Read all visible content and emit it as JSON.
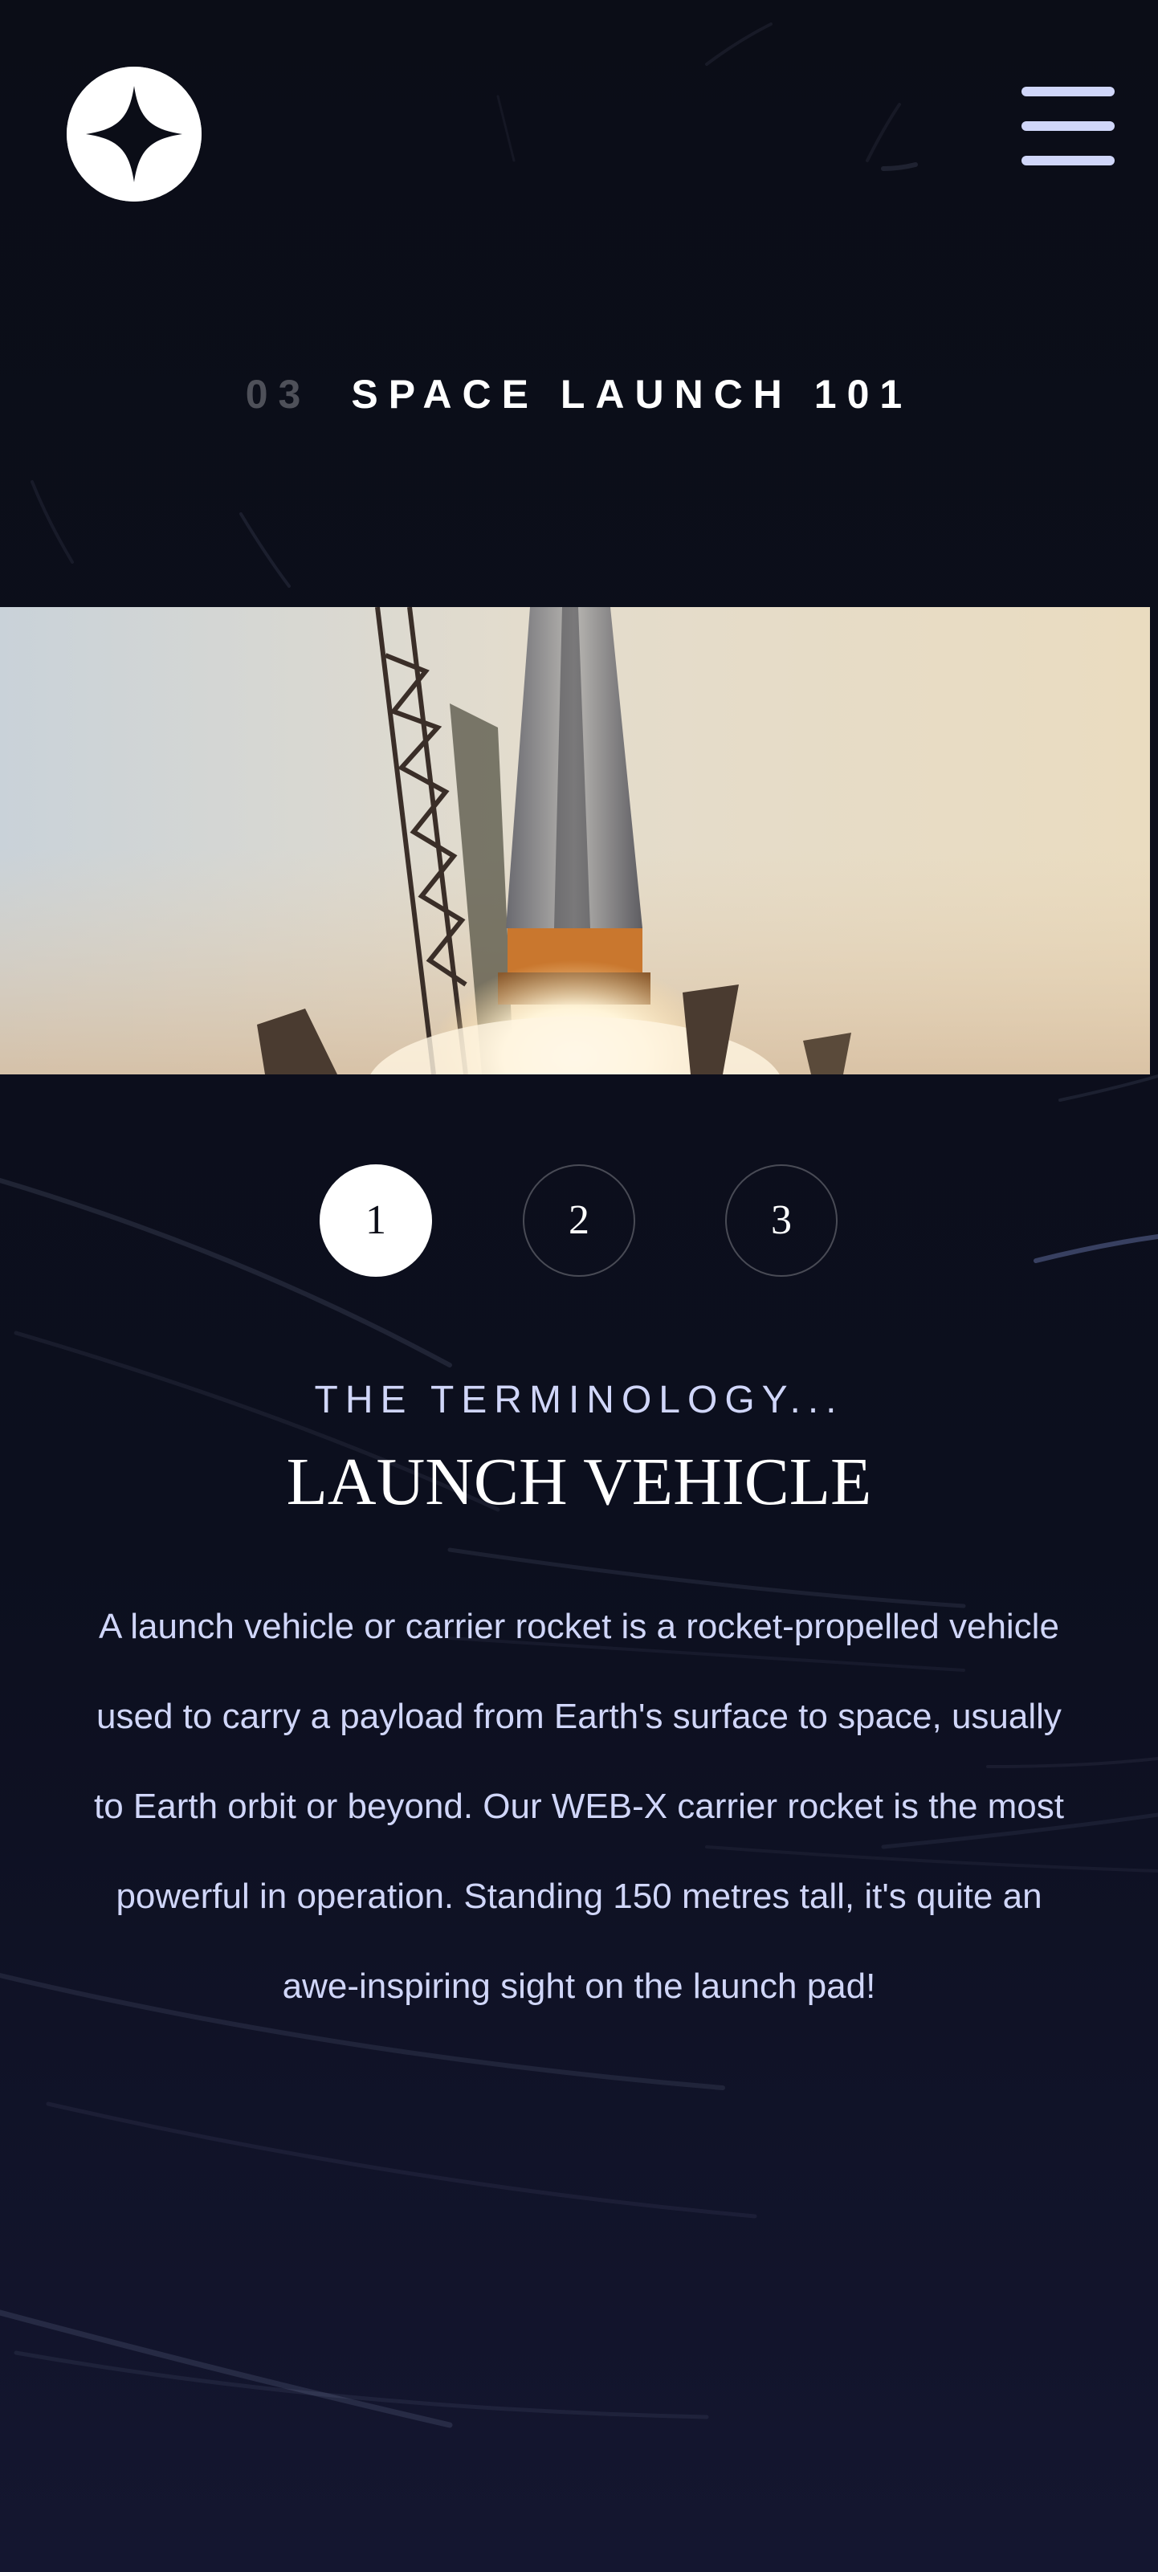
{
  "header": {
    "logo_icon": "four-point-star-icon",
    "menu_icon": "hamburger-menu-icon"
  },
  "heading": {
    "number": "03",
    "title": "SPACE LAUNCH 101"
  },
  "hero_image": {
    "subject": "rocket-launch-photo"
  },
  "pagination": {
    "items": [
      {
        "label": "1",
        "active": true
      },
      {
        "label": "2",
        "active": false
      },
      {
        "label": "3",
        "active": false
      }
    ]
  },
  "content": {
    "eyebrow": "THE TERMINOLOGY...",
    "name": "LAUNCH VEHICLE",
    "description": "A launch vehicle or carrier rocket is a rocket-propelled vehicle used to carry a payload from Earth's surface to space, usually to Earth orbit or beyond. Our WEB-X carrier rocket is the most powerful in operation. Standing 150 metres tall, it's quite an awe-inspiring sight on the launch pad!"
  },
  "colors": {
    "background": "#0b0d17",
    "accent": "#d0d6f9",
    "white": "#ffffff"
  }
}
